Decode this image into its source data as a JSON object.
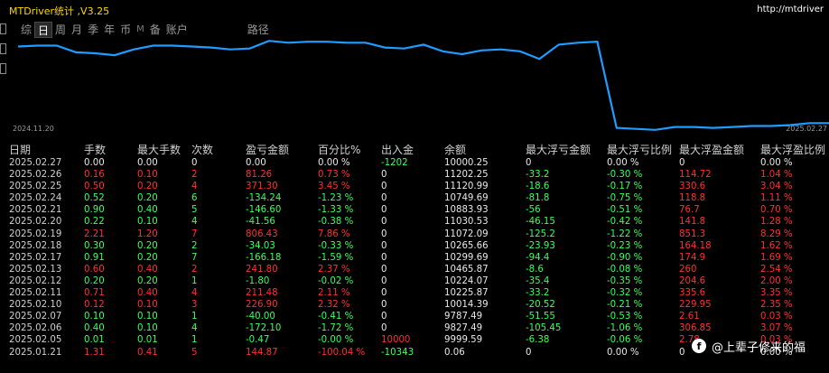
{
  "window": {
    "title": "MTDriver统计 ,V3.25",
    "url": "http://mtdriver"
  },
  "tabs": [
    {
      "label": "综",
      "active": false
    },
    {
      "label": "日",
      "active": true
    },
    {
      "label": "周",
      "active": false
    },
    {
      "label": "月",
      "active": false
    },
    {
      "label": "季",
      "active": false
    },
    {
      "label": "年",
      "active": false
    },
    {
      "label": "币",
      "active": false
    },
    {
      "label": "M",
      "active": false
    },
    {
      "label": "备",
      "active": false
    },
    {
      "label": "账户",
      "active": false
    },
    {
      "label": "路径",
      "active": false
    }
  ],
  "chart": {
    "x_start_label": "2024.11.20",
    "x_end_label": "2025.02.27",
    "line_color": "#1e9cff",
    "values": [
      9,
      8,
      8,
      15,
      16,
      18,
      12,
      8,
      8,
      9,
      10,
      12,
      11,
      3,
      5,
      4,
      4,
      5,
      5,
      10,
      11,
      7,
      14,
      17,
      13,
      12,
      14,
      22,
      7,
      5,
      4,
      94,
      95,
      96,
      93,
      93,
      94,
      93,
      92,
      92,
      91,
      89,
      89
    ]
  },
  "table": {
    "headers": [
      "日期",
      "手数",
      "最大手数",
      "次数",
      "盈亏金额",
      "百分比%",
      "出入金",
      "余额",
      "最大浮亏金额",
      "最大浮亏比例",
      "最大浮盈金额",
      "最大浮盈比例"
    ],
    "rows": [
      {
        "c": [
          "2025.02.27",
          "0.00",
          "0.00",
          "0",
          "0.00",
          "0.00 %",
          "-1202",
          "10000.25",
          "0",
          "0.00 %",
          "0",
          "0.00 %"
        ],
        "k": [
          "date",
          "white",
          "white",
          "white",
          "white",
          "white",
          "green",
          "white",
          "white",
          "white",
          "white",
          "white"
        ]
      },
      {
        "c": [
          "2025.02.26",
          "0.16",
          "0.10",
          "2",
          "81.26",
          "0.73 %",
          "0",
          "11202.25",
          "-33.2",
          "-0.30 %",
          "114.72",
          "1.04 %"
        ],
        "k": [
          "date",
          "red",
          "red",
          "red",
          "red",
          "red",
          "white",
          "white",
          "green",
          "green",
          "red",
          "red"
        ]
      },
      {
        "c": [
          "2025.02.25",
          "0.50",
          "0.20",
          "4",
          "371.30",
          "3.45 %",
          "0",
          "11120.99",
          "-18.6",
          "-0.17 %",
          "330.6",
          "3.04 %"
        ],
        "k": [
          "date",
          "red",
          "red",
          "red",
          "red",
          "red",
          "white",
          "white",
          "green",
          "green",
          "red",
          "red"
        ]
      },
      {
        "c": [
          "2025.02.24",
          "0.52",
          "0.20",
          "6",
          "-134.24",
          "-1.23 %",
          "0",
          "10749.69",
          "-81.8",
          "-0.75 %",
          "118.8",
          "1.11 %"
        ],
        "k": [
          "date",
          "green",
          "green",
          "green",
          "green",
          "green",
          "white",
          "white",
          "green",
          "green",
          "red",
          "red"
        ]
      },
      {
        "c": [
          "2025.02.21",
          "0.90",
          "0.40",
          "5",
          "-146.60",
          "-1.33 %",
          "0",
          "10883.93",
          "-56",
          "-0.51 %",
          "76.7",
          "0.70 %"
        ],
        "k": [
          "date",
          "green",
          "green",
          "green",
          "green",
          "green",
          "white",
          "white",
          "green",
          "green",
          "red",
          "red"
        ]
      },
      {
        "c": [
          "2025.02.20",
          "0.22",
          "0.10",
          "4",
          "-41.56",
          "-0.38 %",
          "0",
          "11030.53",
          "-46.15",
          "-0.42 %",
          "141.8",
          "1.28 %"
        ],
        "k": [
          "date",
          "green",
          "green",
          "green",
          "green",
          "green",
          "white",
          "white",
          "green",
          "green",
          "red",
          "red"
        ]
      },
      {
        "c": [
          "2025.02.19",
          "2.21",
          "1.20",
          "7",
          "806.43",
          "7.86 %",
          "0",
          "11072.09",
          "-125.2",
          "-1.22 %",
          "851.3",
          "8.29 %"
        ],
        "k": [
          "date",
          "red",
          "red",
          "red",
          "red",
          "red",
          "white",
          "white",
          "green",
          "green",
          "red",
          "red"
        ]
      },
      {
        "c": [
          "2025.02.18",
          "0.30",
          "0.20",
          "2",
          "-34.03",
          "-0.33 %",
          "0",
          "10265.66",
          "-23.93",
          "-0.23 %",
          "164.18",
          "1.62 %"
        ],
        "k": [
          "date",
          "green",
          "green",
          "green",
          "green",
          "green",
          "white",
          "white",
          "green",
          "green",
          "red",
          "red"
        ]
      },
      {
        "c": [
          "2025.02.17",
          "0.91",
          "0.20",
          "7",
          "-166.18",
          "-1.59 %",
          "0",
          "10299.69",
          "-94.4",
          "-0.90 %",
          "174.9",
          "1.69 %"
        ],
        "k": [
          "date",
          "green",
          "green",
          "green",
          "green",
          "green",
          "white",
          "white",
          "green",
          "green",
          "red",
          "red"
        ]
      },
      {
        "c": [
          "2025.02.13",
          "0.60",
          "0.40",
          "2",
          "241.80",
          "2.37 %",
          "0",
          "10465.87",
          "-8.6",
          "-0.08 %",
          "260",
          "2.54 %"
        ],
        "k": [
          "date",
          "red",
          "red",
          "red",
          "red",
          "red",
          "white",
          "white",
          "green",
          "green",
          "red",
          "red"
        ]
      },
      {
        "c": [
          "2025.02.12",
          "0.20",
          "0.20",
          "1",
          "-1.80",
          "-0.02 %",
          "0",
          "10224.07",
          "-35.4",
          "-0.35 %",
          "204.6",
          "2.00 %"
        ],
        "k": [
          "date",
          "green",
          "green",
          "green",
          "green",
          "green",
          "white",
          "white",
          "green",
          "green",
          "red",
          "red"
        ]
      },
      {
        "c": [
          "2025.02.11",
          "0.71",
          "0.40",
          "4",
          "211.48",
          "2.11 %",
          "0",
          "10225.87",
          "-33.2",
          "-0.32 %",
          "335.6",
          "3.35 %"
        ],
        "k": [
          "date",
          "red",
          "red",
          "red",
          "red",
          "red",
          "white",
          "white",
          "green",
          "green",
          "red",
          "red"
        ]
      },
      {
        "c": [
          "2025.02.10",
          "0.12",
          "0.10",
          "3",
          "226.90",
          "2.32 %",
          "0",
          "10014.39",
          "-20.52",
          "-0.21 %",
          "229.95",
          "2.35 %"
        ],
        "k": [
          "date",
          "red",
          "red",
          "red",
          "red",
          "red",
          "white",
          "white",
          "green",
          "green",
          "red",
          "red"
        ]
      },
      {
        "c": [
          "2025.02.07",
          "0.10",
          "0.10",
          "1",
          "-40.00",
          "-0.41 %",
          "0",
          "9787.49",
          "-51.55",
          "-0.53 %",
          "2.61",
          "0.03 %"
        ],
        "k": [
          "date",
          "green",
          "green",
          "green",
          "green",
          "green",
          "white",
          "white",
          "green",
          "green",
          "red",
          "red"
        ]
      },
      {
        "c": [
          "2025.02.06",
          "0.40",
          "0.10",
          "4",
          "-172.10",
          "-1.72 %",
          "0",
          "9827.49",
          "-105.45",
          "-1.06 %",
          "306.85",
          "3.07 %"
        ],
        "k": [
          "date",
          "green",
          "green",
          "green",
          "green",
          "green",
          "white",
          "white",
          "green",
          "green",
          "red",
          "red"
        ]
      },
      {
        "c": [
          "2025.02.05",
          "0.01",
          "0.01",
          "1",
          "-0.47",
          "-0.00 %",
          "10000",
          "9999.59",
          "-6.38",
          "-0.06 %",
          "2.78",
          "0.03 %"
        ],
        "k": [
          "date",
          "green",
          "green",
          "green",
          "green",
          "green",
          "red",
          "white",
          "green",
          "green",
          "red",
          "red"
        ]
      },
      {
        "c": [
          "2025.01.21",
          "1.31",
          "0.41",
          "5",
          "144.87",
          "-100.04 %",
          "-10343",
          "0.06",
          "0",
          "0.00 %",
          "0",
          "0.00 %"
        ],
        "k": [
          "date",
          "red",
          "red",
          "red",
          "red",
          "red",
          "green",
          "white",
          "white",
          "white",
          "white",
          "white"
        ]
      }
    ]
  },
  "watermark": {
    "icon": "f",
    "text": "@上辈子修来的福"
  }
}
